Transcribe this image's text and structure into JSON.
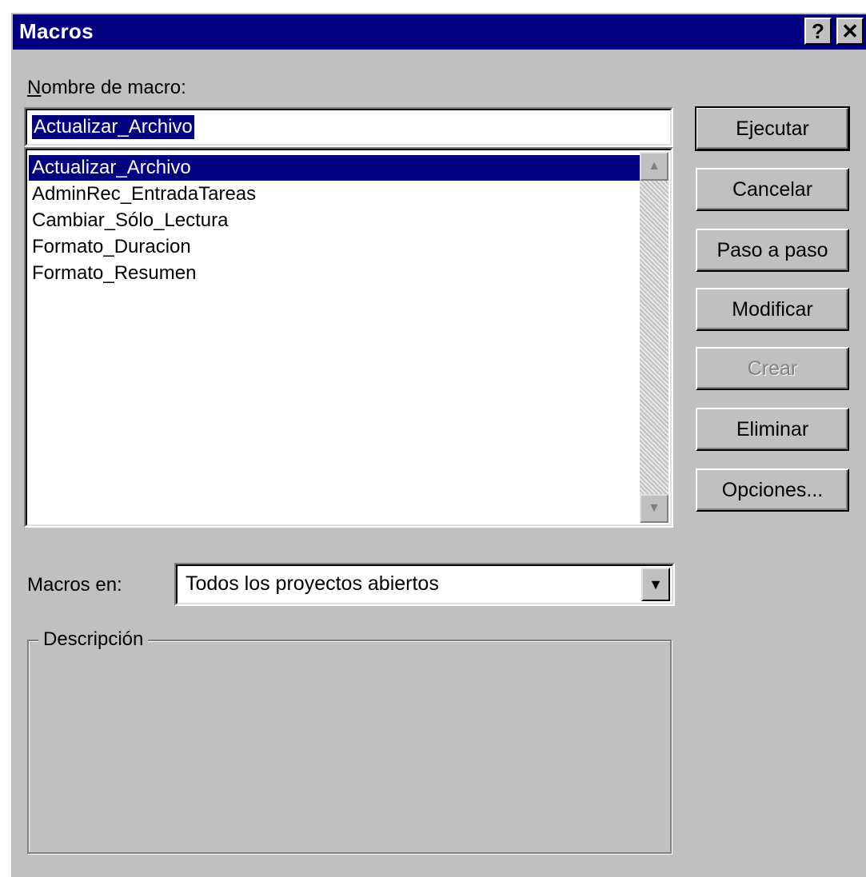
{
  "window": {
    "title": "Macros",
    "help_button": "?",
    "close_button": "✕"
  },
  "macro_name": {
    "label": "Nombre de macro:",
    "value": "Actualizar_Archivo"
  },
  "macro_list": {
    "items": [
      "Actualizar_Archivo",
      "AdminRec_EntradaTareas",
      "Cambiar_Sólo_Lectura",
      "Formato_Duracion",
      "Formato_Resumen"
    ],
    "selected_index": 0
  },
  "buttons": {
    "run": "Ejecutar",
    "cancel": "Cancelar",
    "step": "Paso a paso",
    "edit": "Modificar",
    "create": "Crear",
    "delete": "Eliminar",
    "options": "Opciones..."
  },
  "macros_in": {
    "label": "Macros en:",
    "value": "Todos los proyectos abiertos"
  },
  "description": {
    "legend": "Descripción",
    "text": ""
  },
  "colors": {
    "face": "#c0c0c0",
    "title_bar": "#000080",
    "selection": "#000080"
  }
}
